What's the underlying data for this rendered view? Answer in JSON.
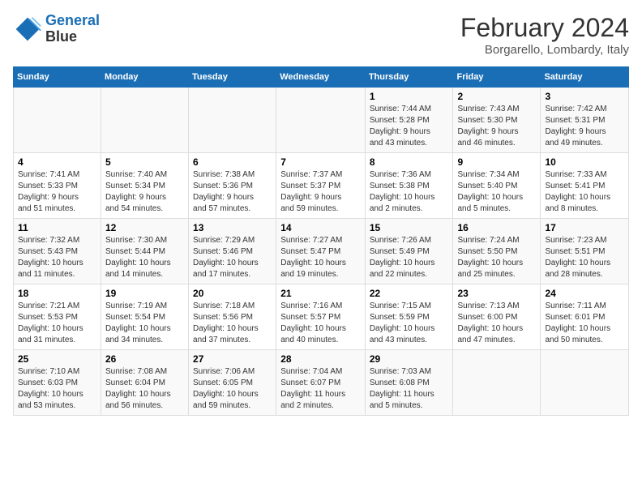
{
  "header": {
    "logo_line1": "General",
    "logo_line2": "Blue",
    "month": "February 2024",
    "location": "Borgarello, Lombardy, Italy"
  },
  "weekdays": [
    "Sunday",
    "Monday",
    "Tuesday",
    "Wednesday",
    "Thursday",
    "Friday",
    "Saturday"
  ],
  "weeks": [
    [
      {
        "day": "",
        "info": ""
      },
      {
        "day": "",
        "info": ""
      },
      {
        "day": "",
        "info": ""
      },
      {
        "day": "",
        "info": ""
      },
      {
        "day": "1",
        "info": "Sunrise: 7:44 AM\nSunset: 5:28 PM\nDaylight: 9 hours\nand 43 minutes."
      },
      {
        "day": "2",
        "info": "Sunrise: 7:43 AM\nSunset: 5:30 PM\nDaylight: 9 hours\nand 46 minutes."
      },
      {
        "day": "3",
        "info": "Sunrise: 7:42 AM\nSunset: 5:31 PM\nDaylight: 9 hours\nand 49 minutes."
      }
    ],
    [
      {
        "day": "4",
        "info": "Sunrise: 7:41 AM\nSunset: 5:33 PM\nDaylight: 9 hours\nand 51 minutes."
      },
      {
        "day": "5",
        "info": "Sunrise: 7:40 AM\nSunset: 5:34 PM\nDaylight: 9 hours\nand 54 minutes."
      },
      {
        "day": "6",
        "info": "Sunrise: 7:38 AM\nSunset: 5:36 PM\nDaylight: 9 hours\nand 57 minutes."
      },
      {
        "day": "7",
        "info": "Sunrise: 7:37 AM\nSunset: 5:37 PM\nDaylight: 9 hours\nand 59 minutes."
      },
      {
        "day": "8",
        "info": "Sunrise: 7:36 AM\nSunset: 5:38 PM\nDaylight: 10 hours\nand 2 minutes."
      },
      {
        "day": "9",
        "info": "Sunrise: 7:34 AM\nSunset: 5:40 PM\nDaylight: 10 hours\nand 5 minutes."
      },
      {
        "day": "10",
        "info": "Sunrise: 7:33 AM\nSunset: 5:41 PM\nDaylight: 10 hours\nand 8 minutes."
      }
    ],
    [
      {
        "day": "11",
        "info": "Sunrise: 7:32 AM\nSunset: 5:43 PM\nDaylight: 10 hours\nand 11 minutes."
      },
      {
        "day": "12",
        "info": "Sunrise: 7:30 AM\nSunset: 5:44 PM\nDaylight: 10 hours\nand 14 minutes."
      },
      {
        "day": "13",
        "info": "Sunrise: 7:29 AM\nSunset: 5:46 PM\nDaylight: 10 hours\nand 17 minutes."
      },
      {
        "day": "14",
        "info": "Sunrise: 7:27 AM\nSunset: 5:47 PM\nDaylight: 10 hours\nand 19 minutes."
      },
      {
        "day": "15",
        "info": "Sunrise: 7:26 AM\nSunset: 5:49 PM\nDaylight: 10 hours\nand 22 minutes."
      },
      {
        "day": "16",
        "info": "Sunrise: 7:24 AM\nSunset: 5:50 PM\nDaylight: 10 hours\nand 25 minutes."
      },
      {
        "day": "17",
        "info": "Sunrise: 7:23 AM\nSunset: 5:51 PM\nDaylight: 10 hours\nand 28 minutes."
      }
    ],
    [
      {
        "day": "18",
        "info": "Sunrise: 7:21 AM\nSunset: 5:53 PM\nDaylight: 10 hours\nand 31 minutes."
      },
      {
        "day": "19",
        "info": "Sunrise: 7:19 AM\nSunset: 5:54 PM\nDaylight: 10 hours\nand 34 minutes."
      },
      {
        "day": "20",
        "info": "Sunrise: 7:18 AM\nSunset: 5:56 PM\nDaylight: 10 hours\nand 37 minutes."
      },
      {
        "day": "21",
        "info": "Sunrise: 7:16 AM\nSunset: 5:57 PM\nDaylight: 10 hours\nand 40 minutes."
      },
      {
        "day": "22",
        "info": "Sunrise: 7:15 AM\nSunset: 5:59 PM\nDaylight: 10 hours\nand 43 minutes."
      },
      {
        "day": "23",
        "info": "Sunrise: 7:13 AM\nSunset: 6:00 PM\nDaylight: 10 hours\nand 47 minutes."
      },
      {
        "day": "24",
        "info": "Sunrise: 7:11 AM\nSunset: 6:01 PM\nDaylight: 10 hours\nand 50 minutes."
      }
    ],
    [
      {
        "day": "25",
        "info": "Sunrise: 7:10 AM\nSunset: 6:03 PM\nDaylight: 10 hours\nand 53 minutes."
      },
      {
        "day": "26",
        "info": "Sunrise: 7:08 AM\nSunset: 6:04 PM\nDaylight: 10 hours\nand 56 minutes."
      },
      {
        "day": "27",
        "info": "Sunrise: 7:06 AM\nSunset: 6:05 PM\nDaylight: 10 hours\nand 59 minutes."
      },
      {
        "day": "28",
        "info": "Sunrise: 7:04 AM\nSunset: 6:07 PM\nDaylight: 11 hours\nand 2 minutes."
      },
      {
        "day": "29",
        "info": "Sunrise: 7:03 AM\nSunset: 6:08 PM\nDaylight: 11 hours\nand 5 minutes."
      },
      {
        "day": "",
        "info": ""
      },
      {
        "day": "",
        "info": ""
      }
    ]
  ]
}
